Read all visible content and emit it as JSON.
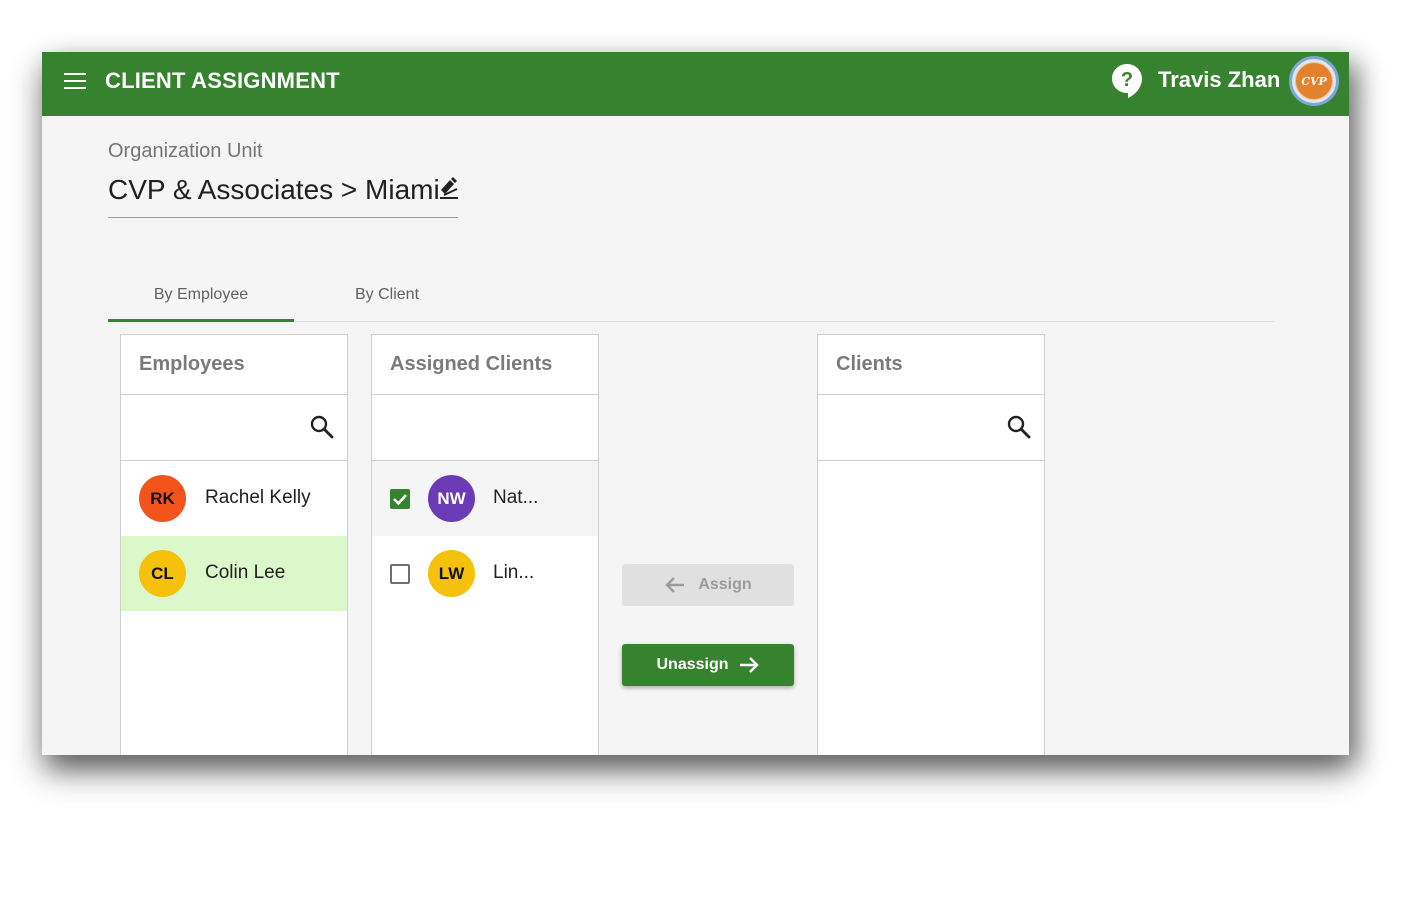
{
  "app": {
    "title": "CLIENT ASSIGNMENT",
    "user_name": "Travis Zhan",
    "avatar_text": "CVP",
    "brand_color": "#37822f"
  },
  "org_unit": {
    "label": "Organization Unit",
    "value": "CVP & Associates > Miami"
  },
  "tabs": [
    {
      "label": "By Employee",
      "active": true
    },
    {
      "label": "By Client",
      "active": false
    }
  ],
  "employees": {
    "header": "Employees",
    "search_placeholder": "",
    "items": [
      {
        "initials": "RK",
        "name": "Rachel Kelly",
        "color": "#f2541b",
        "selected": false
      },
      {
        "initials": "CL",
        "name": "Colin Lee",
        "color": "#f5c10a",
        "selected": true
      }
    ]
  },
  "assigned_clients": {
    "header": "Assigned Clients",
    "items": [
      {
        "initials": "NW",
        "name": "Nat...",
        "color": "#6a3bb4",
        "checked": true
      },
      {
        "initials": "LW",
        "name": "Lin...",
        "color": "#f5c10a",
        "checked": false
      }
    ]
  },
  "actions": {
    "assign_label": "Assign",
    "unassign_label": "Unassign"
  },
  "clients": {
    "header": "Clients",
    "search_placeholder": ""
  },
  "icons": {
    "menu": "menu-icon",
    "help": "help-icon",
    "edit": "edit-icon",
    "search": "search-icon",
    "arrow_left": "arrow-left-icon",
    "arrow_right": "arrow-right-icon",
    "check": "check-icon"
  }
}
